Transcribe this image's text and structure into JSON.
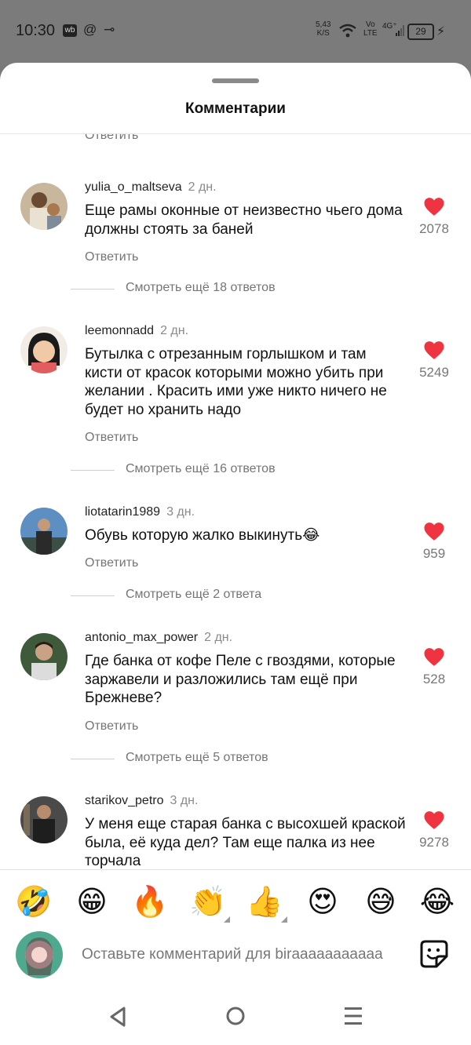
{
  "status_bar": {
    "time": "10:30",
    "badge_wb": "wb",
    "at_icon": "@",
    "key_icon": "⊸",
    "netspeed_value": "5,43",
    "netspeed_unit": "K/S",
    "volte_top": "Vo",
    "volte_bottom": "LTE",
    "signal_label": "4G⁺",
    "battery": "29"
  },
  "sheet": {
    "title": "Комментарии",
    "reply_label": "Ответить"
  },
  "comments": [
    {
      "username": "yulia_o_maltseva",
      "age": "2 дн.",
      "text": "Еще рамы оконные от неизвестно чьего дома должны стоять за баней",
      "likes": "2078",
      "reply": "Ответить",
      "more_replies": "Смотреть ещё 18 ответов"
    },
    {
      "username": "leemonnadd",
      "age": "2 дн.",
      "text": "Бутылка с отрезанным горлышком и там кисти от красок которыми можно убить при желании . Красить ими уже никто ничего не будет но хранить надо",
      "likes": "5249",
      "reply": "Ответить",
      "more_replies": "Смотреть ещё 16 ответов"
    },
    {
      "username": "liotatarin1989",
      "age": "3 дн.",
      "text": "Обувь которую жалко выкинуть😂",
      "likes": "959",
      "reply": "Ответить",
      "more_replies": "Смотреть ещё 2 ответа"
    },
    {
      "username": "antonio_max_power",
      "age": "2 дн.",
      "text": "Где банка от кофе Пеле с гвоздями, которые заржавели и разложились там ещё при Брежневе?",
      "likes": "528",
      "reply": "Ответить",
      "more_replies": "Смотреть ещё 5 ответов"
    },
    {
      "username": "starikov_petro",
      "age": "3 дн.",
      "text": "У меня еще старая банка с высохшей краской была, её куда дел? Там еще палка из нее торчала",
      "likes": "9278"
    }
  ],
  "emoji_bar": [
    "🤣",
    "😁",
    "🔥",
    "👏",
    "👍",
    "😍",
    "😅",
    "😂"
  ],
  "comment_input": {
    "placeholder": "Оставьте комментарий для biraaaaaaaaaaa"
  },
  "colors": {
    "heart": "#ef3340",
    "muted_text": "#757575",
    "overlay": "#7a7a7a"
  }
}
